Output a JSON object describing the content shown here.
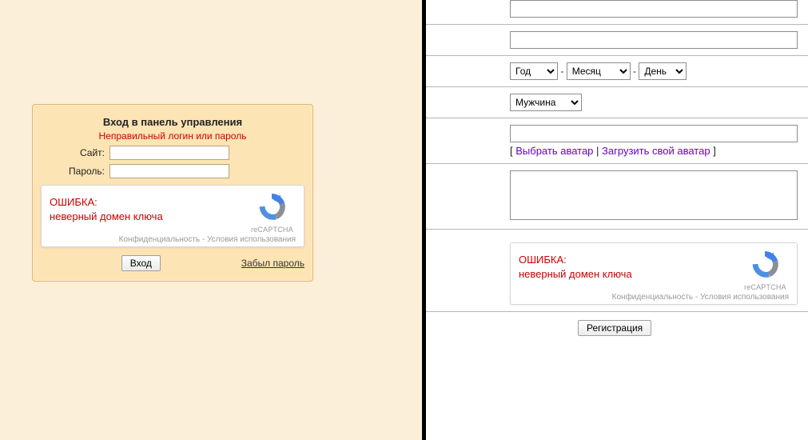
{
  "login": {
    "title": "Вход в панель управления",
    "error": "Неправильный логин или пароль",
    "site_label": "Сайт:",
    "password_label": "Пароль:",
    "submit": "Вход",
    "forgot": "Забыл пароль"
  },
  "captcha": {
    "err1": "ОШИБКА:",
    "err2": "неверный домен ключа",
    "brand": "reCAPTCHA",
    "privacy": "Конфиденциальность",
    "terms": "Условия использования",
    "sep": " - "
  },
  "reg": {
    "year": "Год",
    "month": "Месяц",
    "day": "День",
    "gender": "Мужчина",
    "bracket_open": "[ ",
    "bracket_close": " ]",
    "pipe": " | ",
    "choose_avatar": "Выбрать аватар",
    "upload_avatar": "Загрузить свой аватар",
    "submit": "Регистрация"
  }
}
